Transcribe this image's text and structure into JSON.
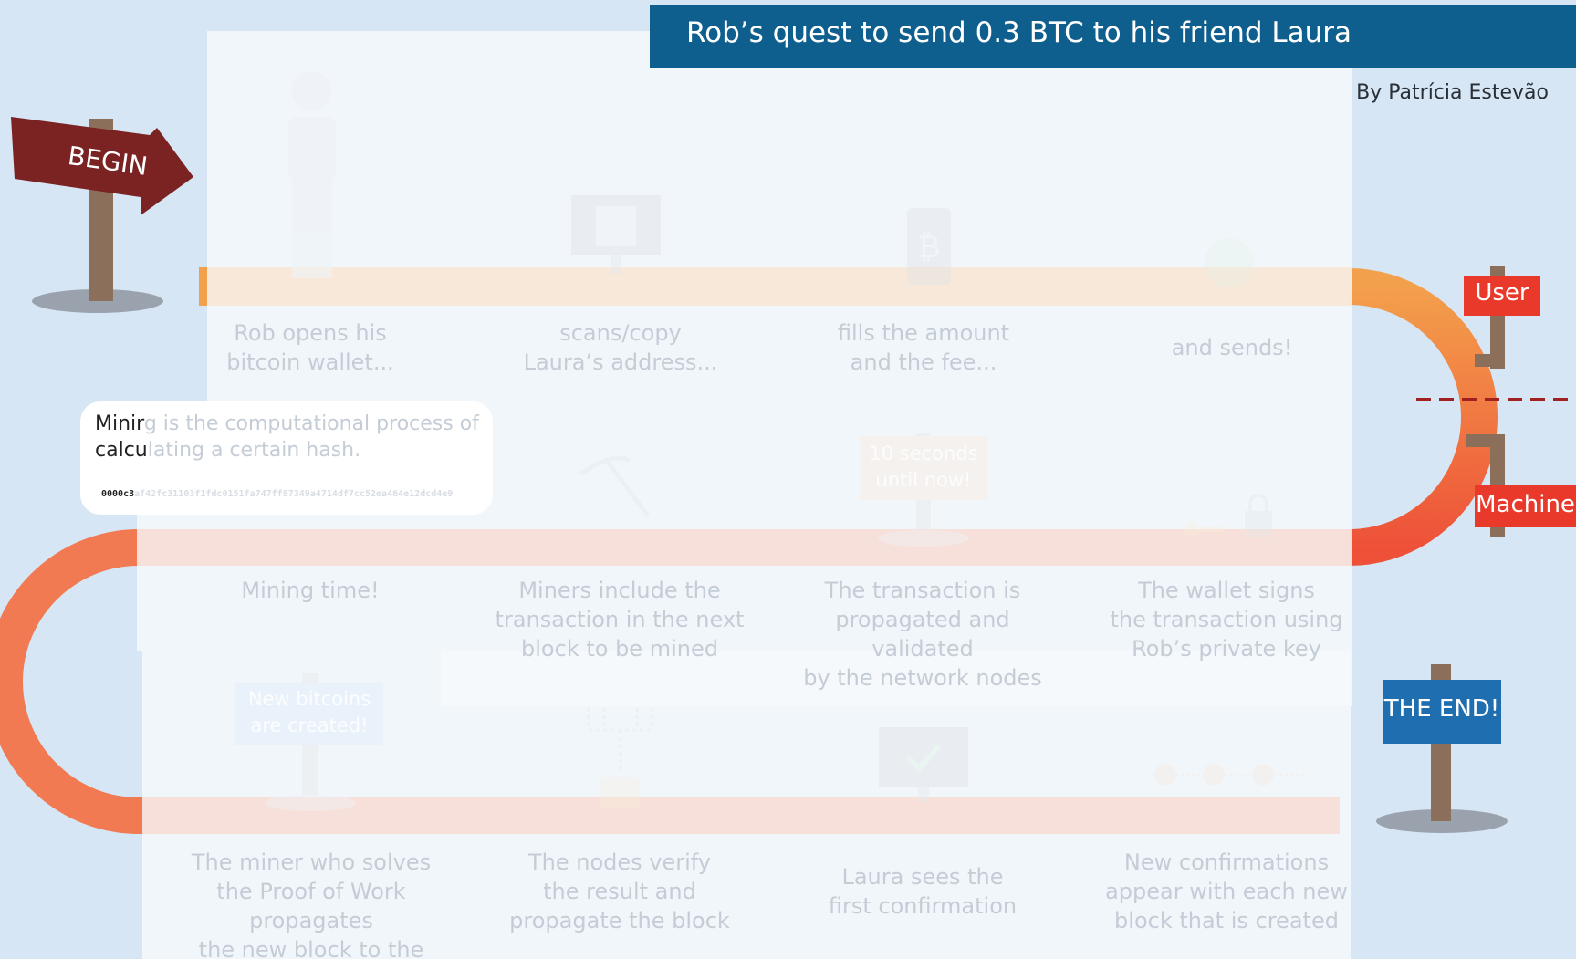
{
  "header": {
    "title": "Rob’s quest to send 0.3 BTC to his friend Laura",
    "byline": "By Patrícia Estevão"
  },
  "signs": {
    "begin": "BEGIN",
    "user": "User",
    "machine": "Machine",
    "end": "THE END!",
    "ten_seconds": "10 seconds\nuntil now!",
    "new_bitcoins": "New bitcoins\nare created!"
  },
  "tooltip": {
    "line1_dark": "Minir",
    "line1_faded": "g is the computational process of",
    "line2_dark": "calcu",
    "line2_faded": "lating a certain hash.",
    "hash_dark": "0000c3",
    "hash_faded": "af42fc31103f1fdc0151fa747ff87349a4714df7cc52ea464e12dcd4e9"
  },
  "steps": {
    "row1": [
      "Rob opens his\nbitcoin wallet...",
      "scans/copy\nLaura’s address...",
      "fills the amount\nand the fee...",
      "and sends!"
    ],
    "row2": [
      "Mining time!",
      "Miners include the\ntransaction in the next\nblock to be mined",
      "The transaction is\npropagated and validated\nby the network nodes",
      "The wallet signs\nthe transaction using\nRob’s private key"
    ],
    "row3": [
      "The miner who solves\nthe Proof of Work propagates\nthe new block to the network",
      "The nodes verify\nthe result and\npropagate the block",
      "Laura sees the\nfirst confirmation",
      "New confirmations\nappear with each new\nblock that is created"
    ]
  },
  "colors": {
    "background": "#d6e6f5",
    "title_bar": "#0f5f8e",
    "begin_sign": "#7a2322",
    "user_tag": "#e8392a",
    "end_sign": "#1f6fb0",
    "path_orange": "#f3a04c",
    "path_red": "#ee5138"
  }
}
